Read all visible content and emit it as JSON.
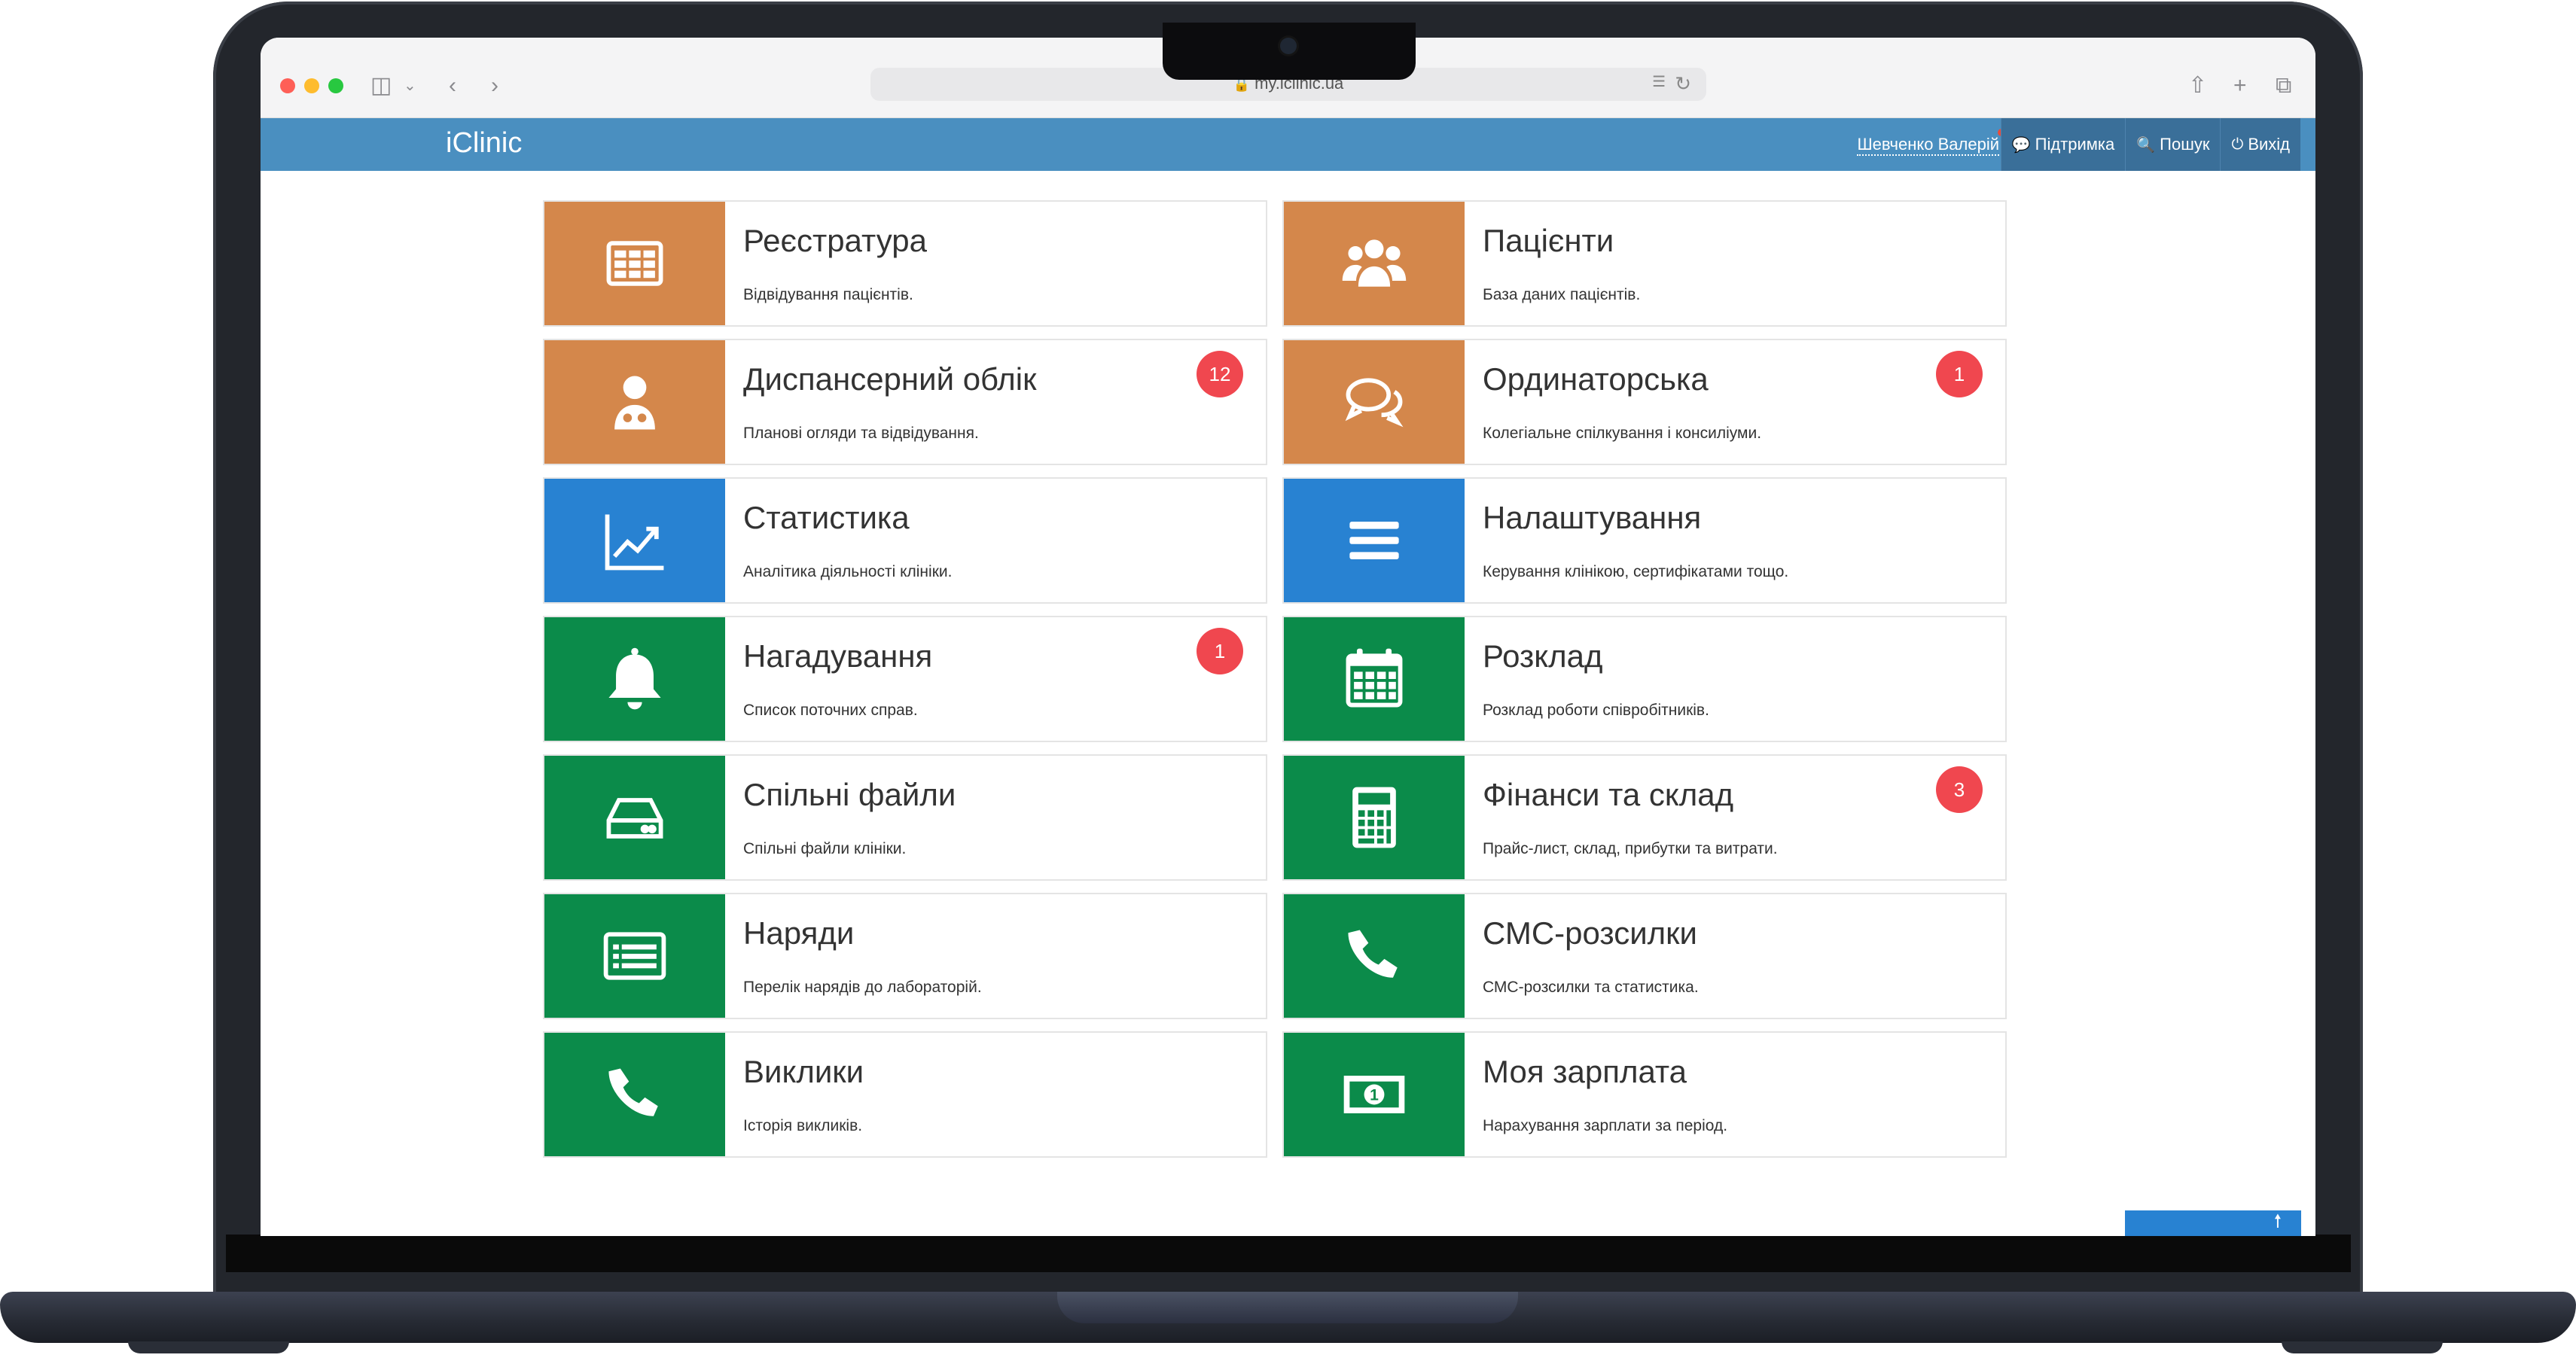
{
  "browser": {
    "url": "my.iclinic.ua",
    "icons": [
      "sidebar-icon",
      "back-icon",
      "forward-icon",
      "share-icon",
      "new-tab-icon",
      "tabs-overview-icon",
      "translate-icon",
      "reload-icon",
      "lock-icon"
    ]
  },
  "header": {
    "brand": "iClinic",
    "user": "Шевченко Валерій",
    "support": "Підтримка",
    "search": "Пошук",
    "logout": "Вихід"
  },
  "colors": {
    "orange": "#d4874b",
    "blue": "#2882d2",
    "green": "#0b8b4a",
    "badge": "#f0474f",
    "header": "#4a8fc0"
  },
  "tiles": [
    {
      "title": "Реєстратура",
      "desc": "Відвідування пацієнтів.",
      "icon": "table-icon",
      "color": "orange",
      "badge": ""
    },
    {
      "title": "Пацієнти",
      "desc": "База даних пацієнтів.",
      "icon": "users-icon",
      "color": "orange",
      "badge": ""
    },
    {
      "title": "Диспансерний облік",
      "desc": "Планові огляди та відвідування.",
      "icon": "doctor-icon",
      "color": "orange",
      "badge": "12"
    },
    {
      "title": "Ординаторська",
      "desc": "Колегіальне спілкування і консиліуми.",
      "icon": "chat-icon",
      "color": "orange",
      "badge": "1"
    },
    {
      "title": "Статистика",
      "desc": "Аналітика діяльності клініки.",
      "icon": "chart-icon",
      "color": "blue",
      "badge": ""
    },
    {
      "title": "Налаштування",
      "desc": "Керування клінікою, сертифікатами тощо.",
      "icon": "menu-icon",
      "color": "blue",
      "badge": ""
    },
    {
      "title": "Нагадування",
      "desc": "Список поточних справ.",
      "icon": "bell-icon",
      "color": "green",
      "badge": "1"
    },
    {
      "title": "Розклад",
      "desc": "Розклад роботи співробітників.",
      "icon": "calendar-icon",
      "color": "green",
      "badge": ""
    },
    {
      "title": "Спільні файли",
      "desc": "Спільні файли клініки.",
      "icon": "hdd-icon",
      "color": "green",
      "badge": ""
    },
    {
      "title": "Фінанси та склад",
      "desc": "Прайс-лист, склад, прибутки та витрати.",
      "icon": "calculator-icon",
      "color": "green",
      "badge": "3"
    },
    {
      "title": "Наряди",
      "desc": "Перелік нарядів до лабораторій.",
      "icon": "list-icon",
      "color": "green",
      "badge": ""
    },
    {
      "title": "СМС-розсилки",
      "desc": "СМС-розсилки та статистика.",
      "icon": "phone-icon",
      "color": "green",
      "badge": ""
    },
    {
      "title": "Виклики",
      "desc": "Історія викликів.",
      "icon": "phone-icon",
      "color": "green",
      "badge": ""
    },
    {
      "title": "Моя зарплата",
      "desc": "Нарахування зарплати за період.",
      "icon": "money-icon",
      "color": "green",
      "badge": ""
    }
  ]
}
